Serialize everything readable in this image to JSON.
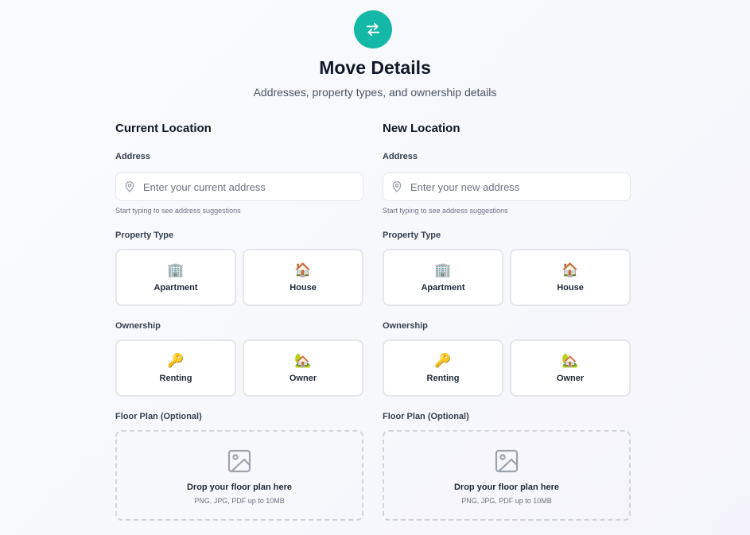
{
  "header": {
    "icon": "swap-arrows-icon",
    "accent_color": "#14b8a6",
    "title": "Move Details",
    "subtitle": "Addresses, property types, and ownership details"
  },
  "current": {
    "section_title": "Current Location",
    "address_label": "Address",
    "address_placeholder": "Enter your current address",
    "address_value": "",
    "address_hint": "Start typing to see address suggestions",
    "property_type_label": "Property Type",
    "property_types": [
      {
        "label": "Apartment",
        "emoji": "🏢"
      },
      {
        "label": "House",
        "emoji": "🏠"
      }
    ],
    "ownership_label": "Ownership",
    "ownership_options": [
      {
        "label": "Renting",
        "emoji": "🔑"
      },
      {
        "label": "Owner",
        "emoji": "🏡"
      }
    ],
    "floor_plan_label": "Floor Plan (Optional)",
    "floor_plan_title": "Drop your floor plan here",
    "floor_plan_hint": "PNG, JPG, PDF up to 10MB"
  },
  "new": {
    "section_title": "New Location",
    "address_label": "Address",
    "address_placeholder": "Enter your new address",
    "address_value": "",
    "address_hint": "Start typing to see address suggestions",
    "property_type_label": "Property Type",
    "property_types": [
      {
        "label": "Apartment",
        "emoji": "🏢"
      },
      {
        "label": "House",
        "emoji": "🏠"
      }
    ],
    "ownership_label": "Ownership",
    "ownership_options": [
      {
        "label": "Renting",
        "emoji": "🔑"
      },
      {
        "label": "Owner",
        "emoji": "🏡"
      }
    ],
    "floor_plan_label": "Floor Plan (Optional)",
    "floor_plan_title": "Drop your floor plan here",
    "floor_plan_hint": "PNG, JPG, PDF up to 10MB"
  }
}
